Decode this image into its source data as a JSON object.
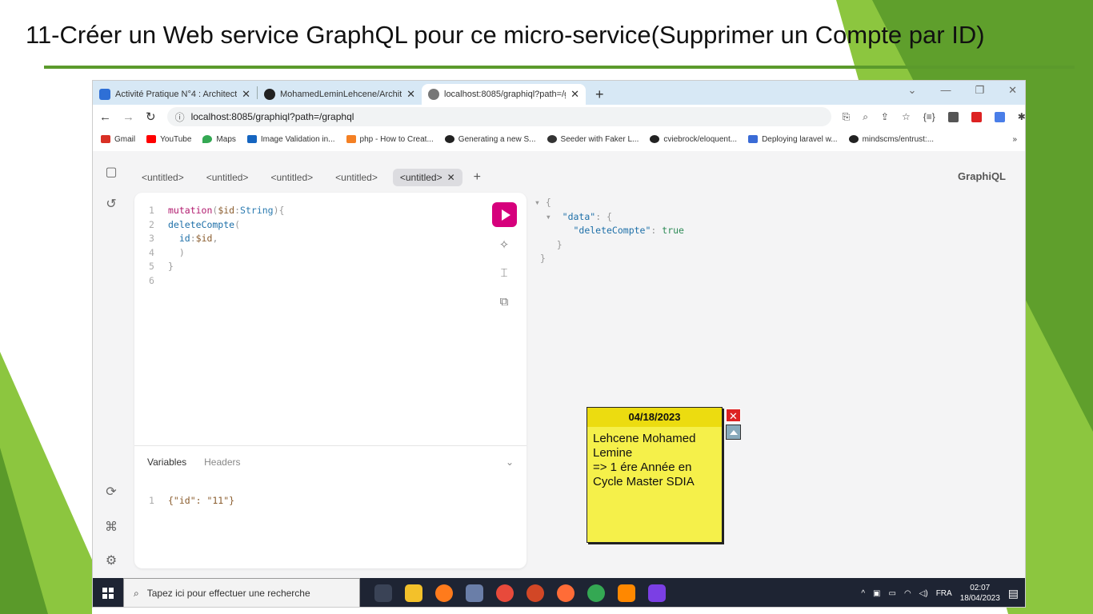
{
  "slide": {
    "title": "11-Créer un Web service GraphQL pour ce micro-service(Supprimer un Compte par ID)",
    "accent_color": "#5b9a2c"
  },
  "browser": {
    "tabs": [
      {
        "title": "Activité Pratique N°4 : Architectu",
        "icon": "doc-icon",
        "active": false
      },
      {
        "title": "MohamedLeminLehcene/Archite",
        "icon": "github-icon",
        "active": false
      },
      {
        "title": "localhost:8085/graphiql?path=/g",
        "icon": "globe-icon",
        "active": true
      }
    ],
    "new_tab": "+",
    "url": "localhost:8085/graphiql?path=/graphql",
    "bookmarks": [
      "Gmail",
      "YouTube",
      "Maps",
      "Image Validation in...",
      "php - How to Creat...",
      "Generating a new S...",
      "Seeder with Faker L...",
      "cviebrock/eloquent...",
      "Deploying laravel w...",
      "mindscms/entrust:..."
    ],
    "bookmarks_more": "»"
  },
  "graphiql": {
    "brand": "GraphiQL",
    "tabs": [
      "<untitled>",
      "<untitled>",
      "<untitled>",
      "<untitled>",
      "<untitled>"
    ],
    "active_tab_index": 4,
    "query_lines": [
      {
        "n": "1",
        "parts": [
          {
            "c": "kw",
            "t": "mutation"
          },
          {
            "c": "pu",
            "t": "("
          },
          {
            "c": "var",
            "t": "$id"
          },
          {
            "c": "pu",
            "t": ":"
          },
          {
            "c": "ty",
            "t": "String"
          },
          {
            "c": "pu",
            "t": "){"
          }
        ]
      },
      {
        "n": "2",
        "parts": [
          {
            "c": "fn",
            "t": "deleteCompte"
          },
          {
            "c": "pu",
            "t": "("
          }
        ]
      },
      {
        "n": "3",
        "parts": [
          {
            "c": "pu",
            "t": "  "
          },
          {
            "c": "fn",
            "t": "id"
          },
          {
            "c": "pu",
            "t": ":"
          },
          {
            "c": "var",
            "t": "$id"
          },
          {
            "c": "pu",
            "t": ","
          }
        ]
      },
      {
        "n": "4",
        "parts": [
          {
            "c": "pu",
            "t": "  )"
          }
        ]
      },
      {
        "n": "5",
        "parts": [
          {
            "c": "pu",
            "t": "}"
          }
        ]
      },
      {
        "n": "6",
        "parts": []
      }
    ],
    "variables_tab": "Variables",
    "headers_tab": "Headers",
    "variables_line_number": "1",
    "variables_json": "{\"id\": \"11\"}",
    "result": {
      "key_data": "\"data\"",
      "key_delete": "\"deleteCompte\"",
      "value": "true"
    }
  },
  "sticky_note": {
    "date": "04/18/2023",
    "text": "Lehcene Mohamed Lemine\n=> 1 ére Année en Cycle Master SDIA"
  },
  "taskbar": {
    "search_placeholder": "Tapez ici pour effectuer une recherche",
    "language": "FRA",
    "time": "02:07",
    "date": "18/04/2023"
  }
}
